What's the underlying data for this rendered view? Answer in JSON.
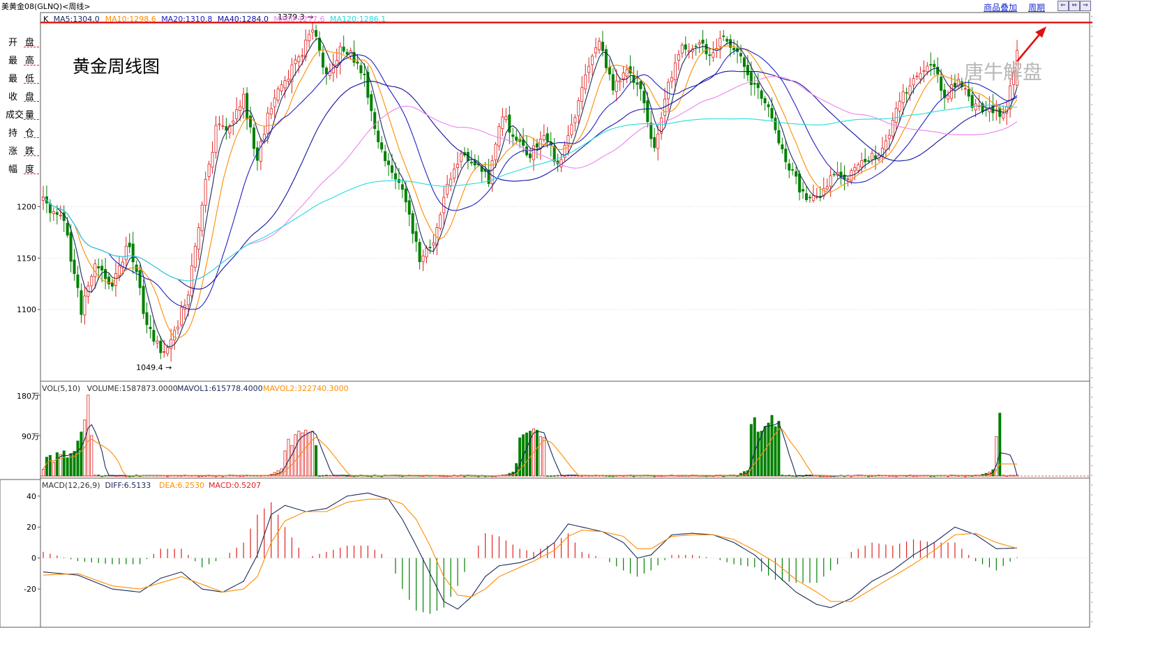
{
  "window": {
    "title": "美黄金08(GLNQ)<周线>"
  },
  "toolbar": {
    "overlay_label": "商品叠加",
    "period_label": "周期",
    "nav_buttons": [
      "⇐",
      "⇔",
      "⇒"
    ]
  },
  "left_panel": {
    "rows": [
      {
        "a": "开",
        "b": "盘"
      },
      {
        "a": "最",
        "b": "高"
      },
      {
        "a": "最",
        "b": "低"
      },
      {
        "a": "收",
        "b": "盘"
      },
      {
        "a": "成交",
        "b": "量"
      },
      {
        "a": "持",
        "b": "仓"
      },
      {
        "a": "涨",
        "b": "跌"
      },
      {
        "a": "幅",
        "b": "度"
      }
    ]
  },
  "annotations": {
    "big_title": "黄金周线图",
    "watermark": "唐牛解盘"
  },
  "colors": {
    "up": "#e02020",
    "down": "#008000",
    "ma5": "#1a2a5a",
    "ma10": "#ff8c00",
    "ma20": "#2020c0",
    "ma40": "#1010a0",
    "ma60": "#ee82ee",
    "ma120": "#22dddd",
    "resistance": "#e01010",
    "frame": "#5a5a5a"
  },
  "chart_data": [
    {
      "type": "candlestick",
      "panel": "price",
      "legend": [
        {
          "label": "K",
          "color": "#000000"
        },
        {
          "label": "MA5:1304.0",
          "color": "#1a2a5a"
        },
        {
          "label": "MA10:1298.6",
          "color": "#ff8c00"
        },
        {
          "label": "MA20:1310.8",
          "color": "#2020c0"
        },
        {
          "label": "MA40:1284.0",
          "color": "#1010a0"
        },
        {
          "label": "MA60:1277.6",
          "color": "#ee82ee"
        },
        {
          "label": "MA120:1286.1",
          "color": "#22dddd"
        }
      ],
      "yticks": [
        1100,
        1150,
        1200
      ],
      "ylim": [
        1033,
        1386
      ],
      "max_label": "1379.3",
      "min_label": "1049.4",
      "resistance_level": 1379,
      "close_anchors": [
        [
          0,
          1205
        ],
        [
          6,
          1185
        ],
        [
          11,
          1100
        ],
        [
          15,
          1145
        ],
        [
          20,
          1125
        ],
        [
          25,
          1165
        ],
        [
          30,
          1085
        ],
        [
          34,
          1062
        ],
        [
          38,
          1078
        ],
        [
          42,
          1118
        ],
        [
          46,
          1205
        ],
        [
          50,
          1275
        ],
        [
          54,
          1280
        ],
        [
          58,
          1305
        ],
        [
          62,
          1245
        ],
        [
          66,
          1300
        ],
        [
          70,
          1322
        ],
        [
          74,
          1345
        ],
        [
          78,
          1372
        ],
        [
          82,
          1328
        ],
        [
          86,
          1352
        ],
        [
          90,
          1345
        ],
        [
          93,
          1328
        ],
        [
          97,
          1258
        ],
        [
          101,
          1237
        ],
        [
          105,
          1208
        ],
        [
          109,
          1148
        ],
        [
          113,
          1168
        ],
        [
          117,
          1220
        ],
        [
          121,
          1250
        ],
        [
          125,
          1245
        ],
        [
          129,
          1225
        ],
        [
          133,
          1290
        ],
        [
          137,
          1262
        ],
        [
          141,
          1250
        ],
        [
          145,
          1270
        ],
        [
          149,
          1240
        ],
        [
          153,
          1280
        ],
        [
          157,
          1325
        ],
        [
          161,
          1360
        ],
        [
          165,
          1318
        ],
        [
          169,
          1330
        ],
        [
          173,
          1318
        ],
        [
          177,
          1255
        ],
        [
          181,
          1320
        ],
        [
          185,
          1352
        ],
        [
          189,
          1360
        ],
        [
          193,
          1350
        ],
        [
          197,
          1362
        ],
        [
          201,
          1352
        ],
        [
          205,
          1322
        ],
        [
          209,
          1305
        ],
        [
          213,
          1262
        ],
        [
          217,
          1232
        ],
        [
          221,
          1205
        ],
        [
          225,
          1212
        ],
        [
          229,
          1230
        ],
        [
          233,
          1228
        ],
        [
          237,
          1245
        ],
        [
          241,
          1248
        ],
        [
          245,
          1272
        ],
        [
          249,
          1310
        ],
        [
          253,
          1325
        ],
        [
          257,
          1340
        ],
        [
          261,
          1308
        ],
        [
          265,
          1322
        ],
        [
          269,
          1300
        ],
        [
          273,
          1295
        ],
        [
          276,
          1290
        ],
        [
          279,
          1296
        ],
        [
          282,
          1350
        ]
      ],
      "series": [
        "MA5",
        "MA10",
        "MA20",
        "MA40",
        "MA60",
        "MA120"
      ]
    },
    {
      "type": "bar",
      "panel": "volume",
      "legend": [
        {
          "label": "VOL(5,10)",
          "color": "#333333"
        },
        {
          "label": "VOLUME:1587873.0000",
          "color": "#333333"
        },
        {
          "label": "MAVOL1:615778.4000",
          "color": "#1a2a5a"
        },
        {
          "label": "MAVOL2:322740.3000",
          "color": "#ff8c00"
        }
      ],
      "ylim": [
        0,
        2000000
      ],
      "ytick_labels": [
        {
          "value": 900000,
          "label": "90万"
        },
        {
          "value": 1800000,
          "label": "180万"
        }
      ],
      "groups": [
        {
          "start": 0,
          "values": [
            150000,
            420000,
            460000,
            300000,
            520000,
            480000,
            560000,
            400000,
            500000,
            550000,
            780000,
            980000,
            1250000,
            1800000,
            900000
          ]
        },
        {
          "start": 66,
          "values": [
            40000,
            80000,
            120000,
            160000,
            560000,
            820000,
            680000,
            920000,
            1000000,
            960000,
            1020000,
            960000,
            1000000,
            680000
          ]
        },
        {
          "start": 134,
          "values": [
            30000,
            60000,
            90000,
            280000,
            850000,
            920000,
            960000,
            1000000,
            1050000,
            1020000,
            880000,
            860000
          ]
        },
        {
          "start": 202,
          "values": [
            60000,
            100000,
            120000,
            1150000,
            1300000,
            980000,
            1000000,
            1100000,
            1180000,
            1350000,
            1100000,
            1220000
          ]
        },
        {
          "start": 271,
          "values": [
            20000,
            40000,
            60000,
            90000,
            140000,
            880000,
            1400000
          ]
        }
      ],
      "total_bars": 283
    },
    {
      "type": "bar+line",
      "panel": "macd",
      "legend": [
        {
          "label": "MACD(12,26,9)",
          "color": "#333333"
        },
        {
          "label": "DIFF:6.5133",
          "color": "#1a2a5a"
        },
        {
          "label": "DEA:6.2530",
          "color": "#ff8c00"
        },
        {
          "label": "MACD:0.5207",
          "color": "#e02020"
        }
      ],
      "ylim": [
        -42,
        48
      ],
      "yticks": [
        -20,
        0,
        20,
        40
      ],
      "diff_anchors": [
        [
          0,
          -9
        ],
        [
          10,
          -11
        ],
        [
          20,
          -20
        ],
        [
          28,
          -22
        ],
        [
          34,
          -13
        ],
        [
          40,
          -9
        ],
        [
          46,
          -20
        ],
        [
          52,
          -22
        ],
        [
          58,
          -15
        ],
        [
          62,
          2
        ],
        [
          66,
          28
        ],
        [
          70,
          34
        ],
        [
          76,
          30
        ],
        [
          82,
          32
        ],
        [
          88,
          40
        ],
        [
          94,
          42
        ],
        [
          100,
          38
        ],
        [
          104,
          25
        ],
        [
          108,
          8
        ],
        [
          112,
          -10
        ],
        [
          116,
          -28
        ],
        [
          120,
          -33
        ],
        [
          124,
          -25
        ],
        [
          128,
          -12
        ],
        [
          132,
          -5
        ],
        [
          138,
          -3
        ],
        [
          142,
          0
        ],
        [
          148,
          10
        ],
        [
          152,
          22
        ],
        [
          156,
          20
        ],
        [
          162,
          17
        ],
        [
          168,
          10
        ],
        [
          172,
          0
        ],
        [
          176,
          2
        ],
        [
          182,
          15
        ],
        [
          188,
          16
        ],
        [
          194,
          15
        ],
        [
          200,
          10
        ],
        [
          206,
          2
        ],
        [
          212,
          -10
        ],
        [
          218,
          -22
        ],
        [
          224,
          -30
        ],
        [
          228,
          -32
        ],
        [
          234,
          -26
        ],
        [
          240,
          -15
        ],
        [
          246,
          -8
        ],
        [
          252,
          2
        ],
        [
          258,
          10
        ],
        [
          264,
          20
        ],
        [
          270,
          15
        ],
        [
          276,
          6
        ],
        [
          282,
          6.5
        ]
      ],
      "dea_anchors": [
        [
          0,
          -11
        ],
        [
          10,
          -10
        ],
        [
          20,
          -18
        ],
        [
          28,
          -20
        ],
        [
          34,
          -16
        ],
        [
          40,
          -12
        ],
        [
          46,
          -17
        ],
        [
          52,
          -22
        ],
        [
          58,
          -20
        ],
        [
          62,
          -12
        ],
        [
          66,
          10
        ],
        [
          70,
          24
        ],
        [
          76,
          30
        ],
        [
          82,
          30
        ],
        [
          88,
          36
        ],
        [
          94,
          38
        ],
        [
          100,
          38
        ],
        [
          104,
          35
        ],
        [
          108,
          25
        ],
        [
          112,
          8
        ],
        [
          116,
          -12
        ],
        [
          120,
          -24
        ],
        [
          124,
          -25
        ],
        [
          128,
          -20
        ],
        [
          132,
          -12
        ],
        [
          138,
          -6
        ],
        [
          142,
          -2
        ],
        [
          148,
          5
        ],
        [
          152,
          14
        ],
        [
          156,
          18
        ],
        [
          162,
          17
        ],
        [
          168,
          14
        ],
        [
          172,
          6
        ],
        [
          176,
          6
        ],
        [
          182,
          14
        ],
        [
          188,
          15
        ],
        [
          194,
          15
        ],
        [
          200,
          12
        ],
        [
          206,
          5
        ],
        [
          212,
          -3
        ],
        [
          218,
          -14
        ],
        [
          224,
          -22
        ],
        [
          228,
          -28
        ],
        [
          234,
          -28
        ],
        [
          240,
          -20
        ],
        [
          246,
          -12
        ],
        [
          252,
          -4
        ],
        [
          258,
          5
        ],
        [
          264,
          15
        ],
        [
          270,
          16
        ],
        [
          276,
          10
        ],
        [
          282,
          6.25
        ]
      ]
    }
  ]
}
